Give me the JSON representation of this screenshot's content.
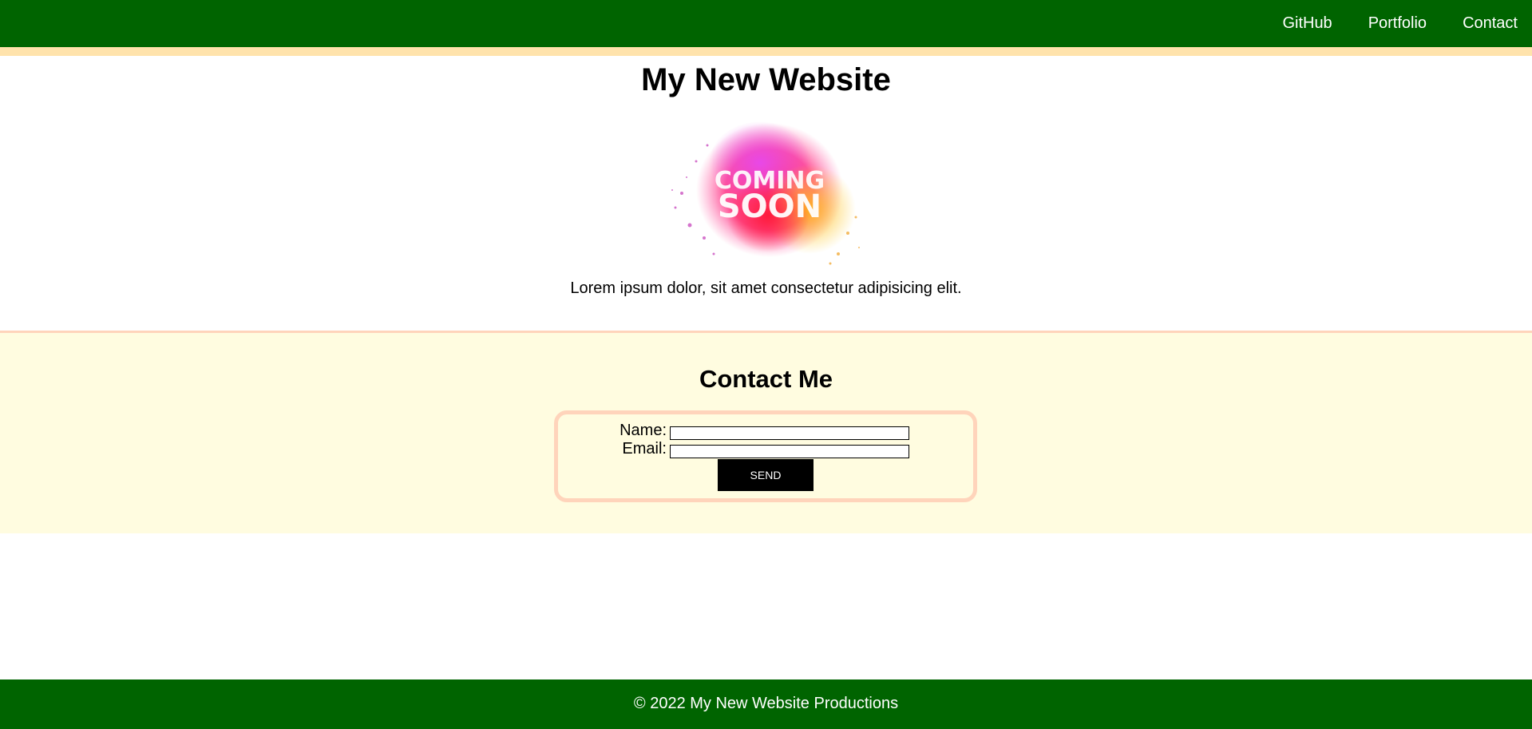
{
  "nav": {
    "links": [
      {
        "label": "GitHub"
      },
      {
        "label": "Portfolio"
      },
      {
        "label": "Contact"
      }
    ]
  },
  "hero": {
    "title": "My New Website",
    "image": {
      "line1": "COMING",
      "line2": "SOON"
    },
    "intro": "Lorem ipsum dolor, sit amet consectetur adipisicing elit."
  },
  "contact": {
    "title": "Contact Me",
    "name_label": "Name:",
    "name_value": "",
    "email_label": "Email:",
    "email_value": "",
    "send_label": "SEND"
  },
  "footer": {
    "text": "© 2022 My New Website Productions"
  },
  "colors": {
    "nav_bg": "#006400",
    "stripe": "#ffe3ac",
    "contact_bg": "#fffce0",
    "form_border": "#ffd4bb",
    "button_bg": "#000000"
  }
}
